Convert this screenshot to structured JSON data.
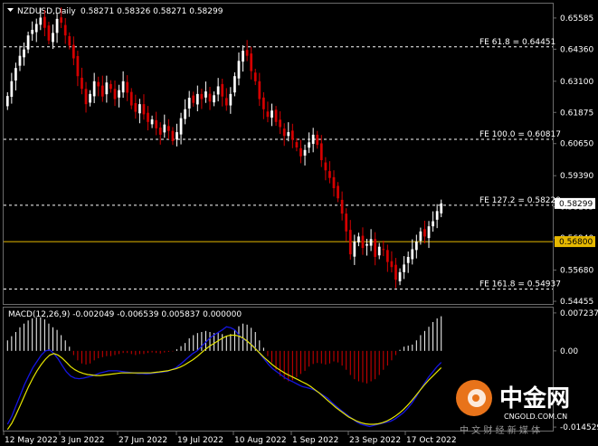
{
  "header": {
    "symbol": "NZDUSD,Daily",
    "ohlc": "0.58271 0.58326 0.58271 0.58299"
  },
  "price_axis": {
    "labels": [
      "0.65585",
      "0.64360",
      "0.63100",
      "0.61875",
      "0.60650",
      "0.59390",
      "0.58165",
      "0.56940",
      "0.55680",
      "0.54455"
    ],
    "values": [
      0.65585,
      0.6436,
      0.631,
      0.61875,
      0.6065,
      0.5939,
      0.58165,
      0.5694,
      0.5568,
      0.54455
    ],
    "current_price": "0.58299",
    "hline_price": "0.56800"
  },
  "fib_levels": [
    {
      "label": "FE 61.8 = 0.64451",
      "value": 0.64451
    },
    {
      "label": "FE 100.0 = 0.60817",
      "value": 0.60817
    },
    {
      "label": "FE 127.2 = 0.58229",
      "value": 0.58229
    },
    {
      "label": "FE 161.8 = 0.54937",
      "value": 0.54937
    }
  ],
  "time_axis": [
    "12 May 2022",
    "3 Jun 2022",
    "27 Jun 2022",
    "19 Jul 2022",
    "10 Aug 2022",
    "1 Sep 2022",
    "23 Sep 2022",
    "17 Oct 2022"
  ],
  "macd": {
    "label": "MACD(12,26,9) -0.002049 -0.006539 0.005837 0.000000",
    "axis_labels": [
      "0.007237",
      "0.00",
      "-0.014529"
    ],
    "axis_values": [
      0.007237,
      0.0,
      -0.014529
    ]
  },
  "watermark": {
    "brand": "中金网",
    "domain": "CNGOLD.COM.CN",
    "tagline": "中 文 财 经 新 媒 体"
  },
  "colors": {
    "background": "#000000",
    "up_candle": "#ffffff",
    "down_candle": "#d40000",
    "fib_line": "#ffffff",
    "hline": "#e6b800",
    "macd_line": "#1515e0",
    "signal_line": "#e6e600",
    "hist_positive": "#ffffff",
    "hist_negative": "#d40000"
  },
  "chart_data": {
    "type": "candlestick",
    "price_range": [
      0.5435,
      0.6615
    ],
    "closes": [
      0.6252,
      0.631,
      0.6362,
      0.641,
      0.6435,
      0.649,
      0.6512,
      0.6535,
      0.656,
      0.652,
      0.647,
      0.65,
      0.6555,
      0.654,
      0.649,
      0.645,
      0.64,
      0.633,
      0.628,
      0.622,
      0.626,
      0.631,
      0.629,
      0.625,
      0.6305,
      0.628,
      0.624,
      0.6275,
      0.631,
      0.6265,
      0.6215,
      0.619,
      0.622,
      0.618,
      0.615,
      0.616,
      0.6125,
      0.61,
      0.614,
      0.6115,
      0.6075,
      0.611,
      0.6165,
      0.62,
      0.6245,
      0.6225,
      0.626,
      0.624,
      0.627,
      0.623,
      0.6255,
      0.629,
      0.625,
      0.6215,
      0.626,
      0.633,
      0.639,
      0.643,
      0.641,
      0.635,
      0.631,
      0.624,
      0.62,
      0.617,
      0.6195,
      0.615,
      0.613,
      0.6095,
      0.611,
      0.608,
      0.605,
      0.6015,
      0.604,
      0.607,
      0.61,
      0.606,
      0.6,
      0.596,
      0.593,
      0.589,
      0.585,
      0.579,
      0.572,
      0.563,
      0.568,
      0.57,
      0.5655,
      0.567,
      0.569,
      0.562,
      0.566,
      0.565,
      0.56,
      0.558,
      0.553,
      0.556,
      0.559,
      0.562,
      0.565,
      0.568,
      0.572,
      0.57,
      0.574,
      0.576,
      0.58,
      0.583
    ],
    "macd_hist": [
      0.002,
      0.0028,
      0.0036,
      0.0045,
      0.0052,
      0.0058,
      0.0062,
      0.0064,
      0.0064,
      0.006,
      0.0052,
      0.0045,
      0.004,
      0.003,
      0.002,
      0.0008,
      -0.0008,
      -0.0018,
      -0.0024,
      -0.0026,
      -0.0024,
      -0.0018,
      -0.0014,
      -0.0012,
      -0.001,
      -0.001,
      -0.0008,
      -0.0006,
      -0.0004,
      -0.0004,
      -0.0006,
      -0.0008,
      -0.0006,
      -0.0006,
      -0.0004,
      -0.0003,
      -0.0004,
      -0.0005,
      -0.0003,
      -0.0002,
      -0.0001,
      0.0003,
      0.0009,
      0.0015,
      0.0024,
      0.003,
      0.0034,
      0.0036,
      0.0038,
      0.0036,
      0.0034,
      0.0036,
      0.0032,
      0.0028,
      0.0032,
      0.004,
      0.0047,
      0.0052,
      0.005,
      0.0044,
      0.0036,
      0.002,
      0.0006,
      -0.001,
      -0.0022,
      -0.0036,
      -0.0048,
      -0.0054,
      -0.0058,
      -0.0056,
      -0.005,
      -0.0044,
      -0.0038,
      -0.003,
      -0.0025,
      -0.0023,
      -0.0024,
      -0.0026,
      -0.0024,
      -0.002,
      -0.0022,
      -0.0028,
      -0.0036,
      -0.0046,
      -0.0054,
      -0.0058,
      -0.006,
      -0.0062,
      -0.0058,
      -0.0054,
      -0.0046,
      -0.0036,
      -0.0028,
      -0.0018,
      -0.0008,
      0.0002,
      0.0008,
      0.001,
      0.0012,
      0.002,
      0.003,
      0.0038,
      0.0046,
      0.0055,
      0.0062,
      0.0066
    ],
    "macd_line": [
      -0.014,
      -0.0125,
      -0.0105,
      -0.0085,
      -0.0065,
      -0.0048,
      -0.0032,
      -0.002,
      -0.0008,
      0.0,
      0.0002,
      -0.0005,
      -0.0015,
      -0.0028,
      -0.004,
      -0.0048,
      -0.0052,
      -0.0053,
      -0.0052,
      -0.005,
      -0.0048,
      -0.0045,
      -0.0042,
      -0.004,
      -0.0038,
      -0.0038,
      -0.0038,
      -0.0039,
      -0.004,
      -0.0041,
      -0.0042,
      -0.0043,
      -0.0043,
      -0.0044,
      -0.0043,
      -0.0042,
      -0.0041,
      -0.004,
      -0.0039,
      -0.0036,
      -0.0032,
      -0.0026,
      -0.0019,
      -0.0012,
      -0.0005,
      0.0,
      0.0008,
      0.0016,
      0.0024,
      0.003,
      0.0035,
      0.004,
      0.0046,
      0.0044,
      0.004,
      0.003,
      0.0022,
      0.0018,
      0.0012,
      0.0004,
      -0.0006,
      -0.0016,
      -0.0026,
      -0.0034,
      -0.004,
      -0.0046,
      -0.0052,
      -0.0056,
      -0.006,
      -0.0064,
      -0.0068,
      -0.007,
      -0.0072,
      -0.0075,
      -0.008,
      -0.0085,
      -0.009,
      -0.0098,
      -0.0105,
      -0.0112,
      -0.0118,
      -0.0124,
      -0.013,
      -0.0136,
      -0.014,
      -0.0142,
      -0.0144,
      -0.0142,
      -0.014,
      -0.0138,
      -0.0136,
      -0.0134,
      -0.013,
      -0.0124,
      -0.0118,
      -0.011,
      -0.01,
      -0.0088,
      -0.0075,
      -0.0062,
      -0.005,
      -0.004,
      -0.003,
      -0.0022
    ],
    "signal_line": [
      -0.015,
      -0.0138,
      -0.0122,
      -0.0104,
      -0.0086,
      -0.0068,
      -0.0052,
      -0.0038,
      -0.0026,
      -0.0016,
      -0.0008,
      -0.0005,
      -0.0008,
      -0.0014,
      -0.0022,
      -0.003,
      -0.0036,
      -0.004,
      -0.0043,
      -0.0045,
      -0.0046,
      -0.0047,
      -0.0047,
      -0.0046,
      -0.0045,
      -0.0044,
      -0.0043,
      -0.0042,
      -0.0042,
      -0.0042,
      -0.0042,
      -0.0042,
      -0.0042,
      -0.0042,
      -0.0042,
      -0.0041,
      -0.004,
      -0.0039,
      -0.0038,
      -0.0036,
      -0.0034,
      -0.0031,
      -0.0027,
      -0.0022,
      -0.0017,
      -0.0011,
      -0.0004,
      0.0003,
      0.0009,
      0.0014,
      0.0019,
      0.0024,
      0.0028,
      0.003,
      0.003,
      0.0028,
      0.0024,
      0.0018,
      0.0011,
      0.0003,
      -0.0005,
      -0.0013,
      -0.002,
      -0.0027,
      -0.0033,
      -0.0038,
      -0.0043,
      -0.0047,
      -0.0051,
      -0.0055,
      -0.0059,
      -0.0063,
      -0.0068,
      -0.0074,
      -0.008,
      -0.0087,
      -0.0094,
      -0.0101,
      -0.0108,
      -0.0114,
      -0.012,
      -0.0126,
      -0.013,
      -0.0134,
      -0.0137,
      -0.0139,
      -0.014,
      -0.014,
      -0.0139,
      -0.0137,
      -0.0134,
      -0.013,
      -0.0125,
      -0.0119,
      -0.0112,
      -0.0104,
      -0.0095,
      -0.0085,
      -0.0075,
      -0.0065,
      -0.0056,
      -0.0048,
      -0.004,
      -0.0032
    ]
  }
}
